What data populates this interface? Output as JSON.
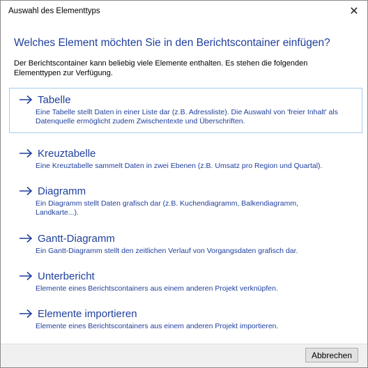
{
  "window": {
    "title": "Auswahl des Elementtyps",
    "close_glyph": "✕"
  },
  "heading": "Welches Element möchten Sie in den Berichtscontainer einfügen?",
  "intro": "Der Berichtscontainer kann beliebig viele Elemente enthalten. Es stehen die folgenden Elementtypen zur Verfügung.",
  "accent_color": "#1f3f9c",
  "options": [
    {
      "label": "Tabelle",
      "description": "Eine Tabelle stellt Daten in einer Liste dar (z.B. Adressliste). Die Auswahl von 'freier Inhalt' als Datenquelle ermöglicht zudem Zwischentexte und Überschriften.",
      "icon": "arrow-right-icon",
      "selected": true
    },
    {
      "label": "Kreuztabelle",
      "description": "Eine Kreuztabelle sammelt Daten in zwei Ebenen (z.B. Umsatz pro Region und Quartal).",
      "icon": "arrow-right-icon"
    },
    {
      "label": "Diagramm",
      "description": "Ein Diagramm stellt Daten grafisch dar (z.B. Kuchendiagramm, Balkendiagramm, Landkarte...).",
      "icon": "arrow-right-icon"
    },
    {
      "label": "Gantt-Diagramm",
      "description": "Ein Gantt-Diagramm stellt den zeitlichen Verlauf von Vorgangsdaten grafisch dar.",
      "icon": "arrow-right-icon"
    },
    {
      "label": "Unterbericht",
      "description": "Elemente eines Berichtscontainers aus einem anderen Projekt verknüpfen.",
      "icon": "arrow-right-icon"
    },
    {
      "label": "Elemente importieren",
      "description": "Elemente eines Berichtscontainers aus einem anderen Projekt importieren.",
      "icon": "arrow-right-icon"
    }
  ],
  "footer": {
    "cancel_label": "Abbrechen"
  }
}
